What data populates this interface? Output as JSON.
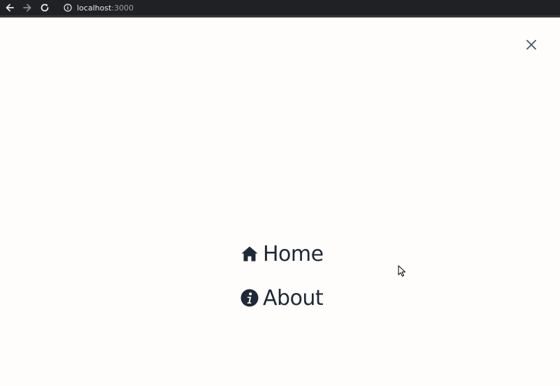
{
  "browser": {
    "url_host": "localhost",
    "url_port": ":3000",
    "icons": {
      "back": "arrow-left-icon",
      "forward": "arrow-right-icon",
      "reload": "reload-icon",
      "info": "info-circle-icon"
    }
  },
  "page": {
    "close_icon": "close-icon",
    "menu": {
      "items": [
        {
          "label": "Home",
          "icon": "home-icon"
        },
        {
          "label": "About",
          "icon": "info-circle-icon"
        }
      ]
    }
  },
  "colors": {
    "background": "#fefdfb",
    "text": "#1f2937",
    "browser_bar": "#202124",
    "close_icon": "#4b5563"
  }
}
